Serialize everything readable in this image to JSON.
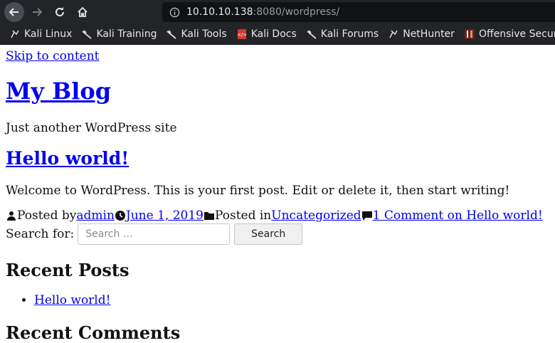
{
  "browser": {
    "url_host": "10.10.10.138",
    "url_rest": ":8080/wordpress/",
    "bookmarks": [
      {
        "label": "Kali Linux",
        "icon": "kali-dragon-icon"
      },
      {
        "label": "Kali Training",
        "icon": "kali-dragon-icon"
      },
      {
        "label": "Kali Tools",
        "icon": "kali-dragon-icon"
      },
      {
        "label": "Kali Docs",
        "icon": "kali-docs-icon"
      },
      {
        "label": "Kali Forums",
        "icon": "kali-dragon-icon"
      },
      {
        "label": "NetHunter",
        "icon": "kali-dragon-icon"
      },
      {
        "label": "Offensive Security",
        "icon": "offsec-icon"
      }
    ],
    "bookmarks_overflow": "«"
  },
  "site": {
    "skip_link": "Skip to content",
    "title": "My Blog",
    "tagline": "Just another WordPress site"
  },
  "post": {
    "title": "Hello world!",
    "body": "Welcome to WordPress. This is your first post. Edit or delete it, then start writing!",
    "posted_by_label": "Posted by",
    "author": "admin",
    "date": "June 1, 2019",
    "posted_in_label": "Posted in",
    "category": "Uncategorized",
    "comments": "1 Comment on Hello world!"
  },
  "search": {
    "label": "Search for:",
    "placeholder": "Search …",
    "button": "Search"
  },
  "widgets": {
    "recent_posts_title": "Recent Posts",
    "recent_posts": [
      "Hello world!"
    ],
    "recent_comments_title": "Recent Comments"
  }
}
